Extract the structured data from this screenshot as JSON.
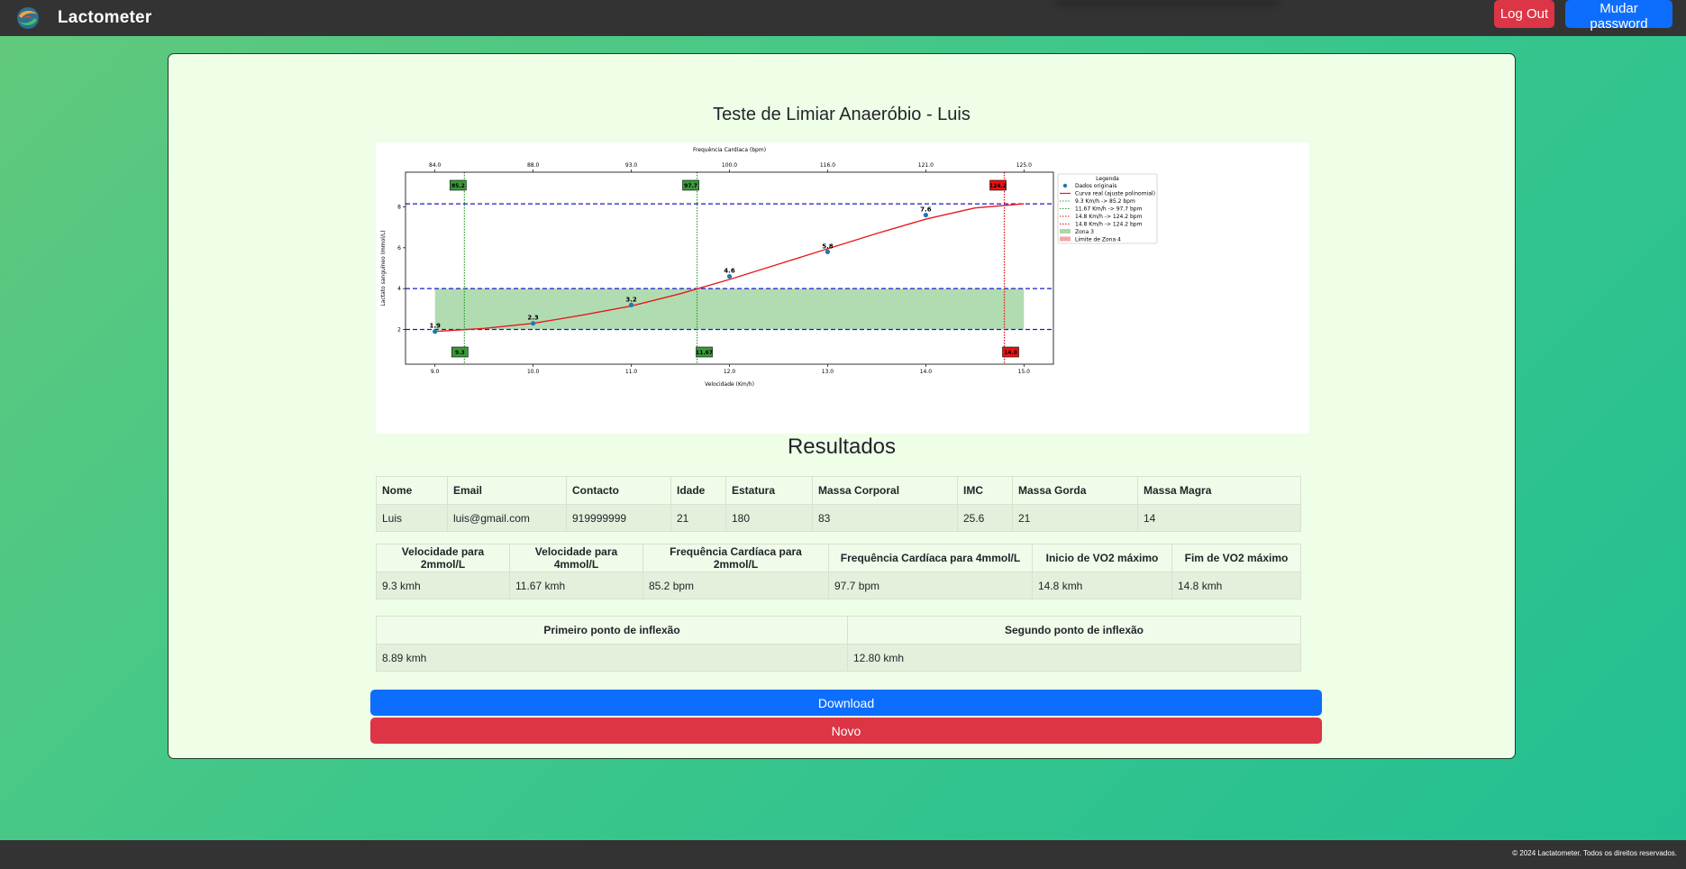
{
  "app": {
    "name": "Lactometer",
    "logo_icon": "swirl-logo-icon"
  },
  "nav": {
    "logout_label": "Log Out",
    "password_label": "Mudar password"
  },
  "page": {
    "title": "Teste de Limiar Anaeróbio - Luis",
    "results_title": "Resultados"
  },
  "chart_data": {
    "type": "scatter",
    "title": "",
    "xlabel": "Velocidade (Km/h)",
    "ylabel": "Lactato sanguíneo (mmol/L)",
    "top_xlabel": "Frequência Cardíaca (bpm)",
    "xlim": [
      8.7,
      15.3
    ],
    "ylim": [
      0.3,
      9.7
    ],
    "x_ticks": [
      9.0,
      10.0,
      11.0,
      12.0,
      13.0,
      14.0,
      15.0
    ],
    "x_tick_labels": [
      "9.0",
      "10.0",
      "11.0",
      "12.0",
      "13.0",
      "14.0",
      "15.0"
    ],
    "y_ticks": [
      2,
      4,
      6,
      8
    ],
    "top_tick_labels": [
      "84.0",
      "88.0",
      "93.0",
      "100.0",
      "116.0",
      "121.0",
      "125.0"
    ],
    "series": [
      {
        "name": "Dados originais",
        "type": "scatter",
        "color": "#1f77b4",
        "x": [
          9,
          10,
          11,
          12,
          13,
          14
        ],
        "y": [
          1.9,
          2.3,
          3.2,
          4.6,
          5.8,
          7.6
        ],
        "labels": [
          "1.9",
          "2.3",
          "3.2",
          "4.6",
          "5.8",
          "7.6"
        ]
      },
      {
        "name": "Curva real (ajuste polinomial)",
        "type": "line",
        "color": "#e8191d",
        "x": [
          9.0,
          9.5,
          10.0,
          10.5,
          11.0,
          11.5,
          12.0,
          12.5,
          13.0,
          13.5,
          14.0,
          14.5,
          15.0
        ],
        "y": [
          1.9,
          2.05,
          2.3,
          2.7,
          3.15,
          3.75,
          4.45,
          5.2,
          5.95,
          6.7,
          7.4,
          7.95,
          8.15
        ]
      }
    ],
    "hlines": [
      2,
      4,
      8.15
    ],
    "vlines": [
      {
        "x": 9.3,
        "color": "#2ca02c",
        "label": "9.3 Km/h -> 85.2 bpm",
        "top_label": "85.2",
        "bottom_label": "9.3"
      },
      {
        "x": 11.67,
        "color": "#2ca02c",
        "label": "11.67 Km/h -> 97.7 bpm",
        "top_label": "97.7",
        "bottom_label": "11.67"
      },
      {
        "x": 14.8,
        "color": "#e8191d",
        "label": "14.8 Km/h -> 124.2 bpm",
        "top_label": "124.2",
        "bottom_label": "14.8"
      },
      {
        "x": 14.8,
        "color": "#e8191d",
        "label": "14.8 Km/h -> 124.2 bpm",
        "top_label": "",
        "bottom_label": ""
      }
    ],
    "zone": {
      "x": [
        9.0,
        15.0
      ],
      "y": [
        2,
        4
      ],
      "label": "Zona 3",
      "color": "#a9d8a9"
    },
    "zone4_label": "Limite de Zona 4",
    "zone4_color": "#f4a6a6",
    "legend_title": "Legenda",
    "legend_position": "right outside"
  },
  "table1": {
    "headers": [
      "Nome",
      "Email",
      "Contacto",
      "Idade",
      "Estatura",
      "Massa Corporal",
      "IMC",
      "Massa Gorda",
      "Massa Magra"
    ],
    "row": [
      "Luis",
      "luis@gmail.com",
      "919999999",
      "21",
      "180",
      "83",
      "25.6",
      "21",
      "14"
    ]
  },
  "table2": {
    "headers": [
      "Velocidade para 2mmol/L",
      "Velocidade para 4mmol/L",
      "Frequência Cardíaca para 2mmol/L",
      "Frequência Cardíaca para 4mmol/L",
      "Inicio de VO2 máximo",
      "Fim de VO2 máximo"
    ],
    "row": [
      "9.3 kmh",
      "11.67 kmh",
      "85.2 bpm",
      "97.7 bpm",
      "14.8 kmh",
      "14.8 kmh"
    ]
  },
  "table3": {
    "headers": [
      "Primeiro ponto de inflexão",
      "Segundo ponto de inflexão"
    ],
    "row": [
      "8.89 kmh",
      "12.80 kmh"
    ]
  },
  "actions": {
    "download_label": "Download",
    "novo_label": "Novo"
  },
  "footer": {
    "text": "© 2024 Lactatometer. Todos os direitos reservados."
  }
}
